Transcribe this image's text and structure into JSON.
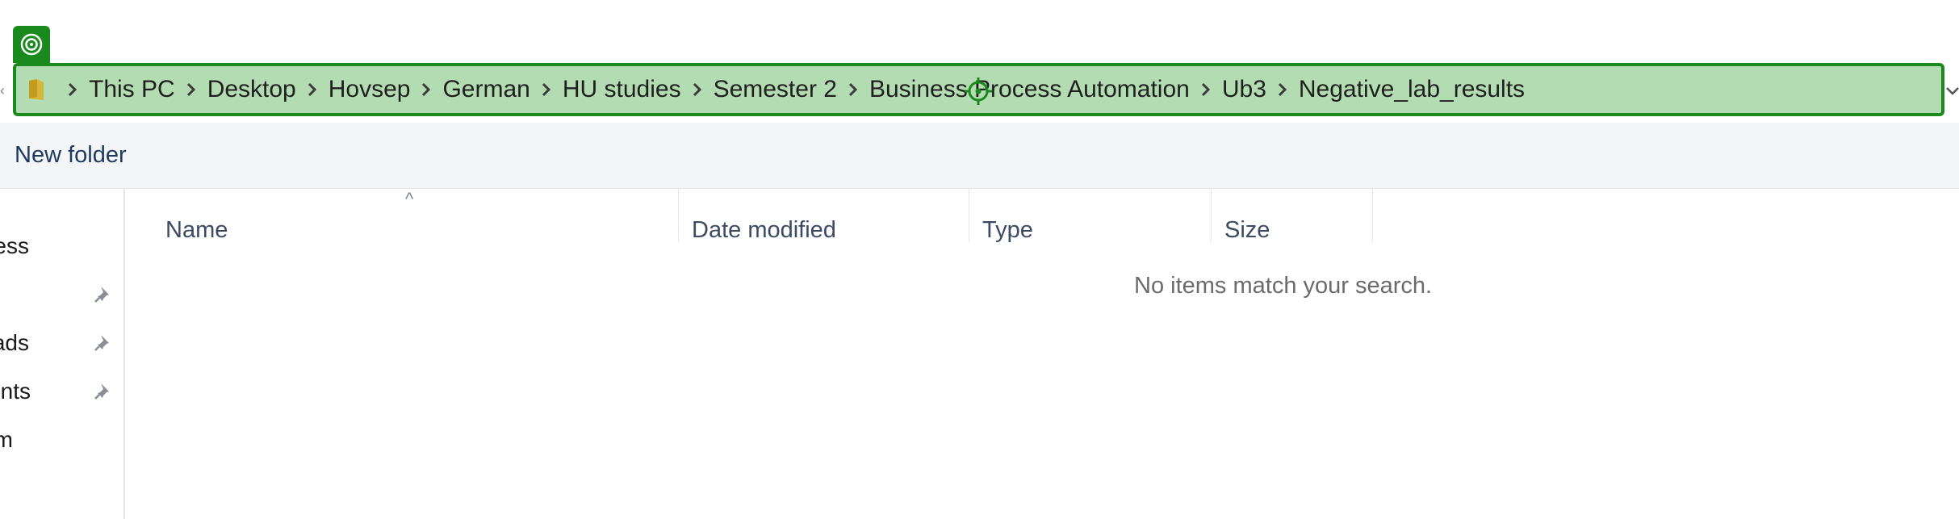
{
  "address_bar": {
    "breadcrumbs": [
      {
        "label": "This PC"
      },
      {
        "label": "Desktop"
      },
      {
        "label": "Hovsep"
      },
      {
        "label": "German"
      },
      {
        "label": "HU studies"
      },
      {
        "label": "Semester 2"
      },
      {
        "label": "Business Process Automation"
      },
      {
        "label": "Ub3"
      },
      {
        "label": "Negative_lab_results"
      }
    ],
    "highlight_color": "#1a8a1f",
    "highlight_fill": "#b4dcb2"
  },
  "toolbar": {
    "new_folder_label": "New folder"
  },
  "nav_pane": {
    "items": [
      {
        "label": "Quick access",
        "pinned": false
      },
      {
        "label": "",
        "pinned": true
      },
      {
        "label": "Downloads",
        "pinned": true
      },
      {
        "label": "Documents",
        "pinned": true
      },
      {
        "label": "Programm",
        "pinned": false
      }
    ]
  },
  "file_list": {
    "columns": [
      {
        "label": "Name"
      },
      {
        "label": "Date modified"
      },
      {
        "label": "Type"
      },
      {
        "label": "Size"
      }
    ],
    "sort_indicator": "^",
    "empty_message": "No items match your search."
  },
  "icons": {
    "overlay_badge": "target-ring-icon",
    "folder": "folder-icon",
    "separator": "chevron-right-icon",
    "pin": "pin-icon",
    "dropdown": "chevron-down-icon",
    "marker": "crosshair-icon"
  }
}
